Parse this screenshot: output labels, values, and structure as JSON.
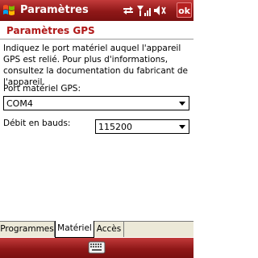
{
  "titlebar": {
    "title": "Paramètres",
    "ok_label": "ok",
    "color": "#8f1818",
    "icons": [
      "start-flag-icon",
      "connectivity-icon",
      "signal-icon",
      "volume-icon"
    ]
  },
  "page": {
    "heading": "Paramètres GPS",
    "heading_color": "#b01818",
    "description": "Indiquez le port matériel auquel l'appareil GPS est relié. Pour plus d'informations, consultez la documentation du fabricant de l'appareil."
  },
  "fields": {
    "port_label": "Port matériel GPS:",
    "port_value": "COM4",
    "baud_label": "Débit en bauds:",
    "baud_value": "115200"
  },
  "tabs": [
    {
      "label": "Programmes",
      "active": false
    },
    {
      "label": "Matériel",
      "active": true
    },
    {
      "label": "Accès",
      "active": false
    }
  ],
  "bottombar": {
    "icon": "keyboard-icon"
  }
}
